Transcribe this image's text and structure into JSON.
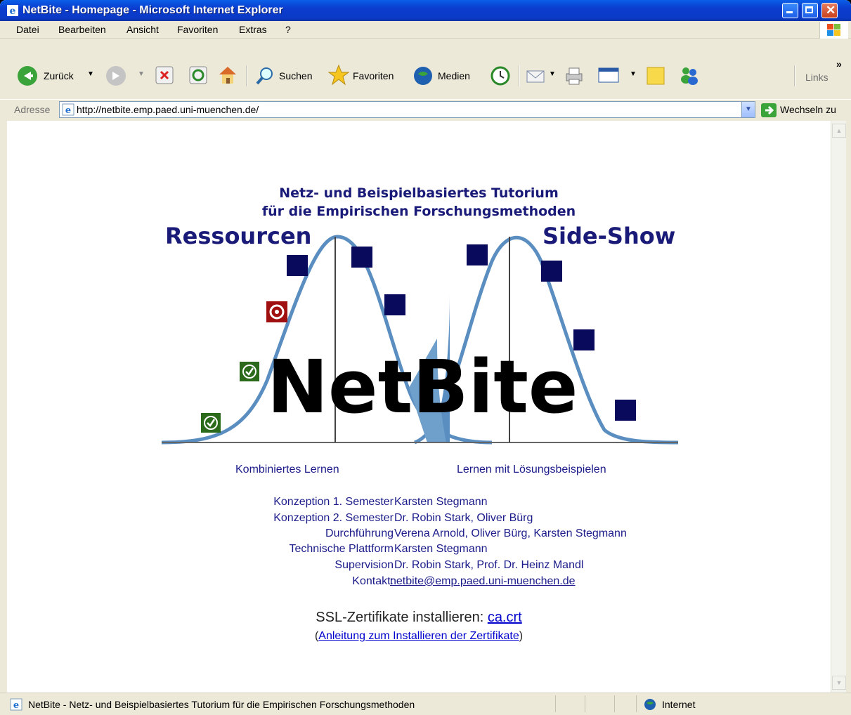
{
  "window": {
    "title": "NetBite - Homepage - Microsoft Internet Explorer"
  },
  "menu": [
    "Datei",
    "Bearbeiten",
    "Ansicht",
    "Favoriten",
    "Extras",
    "?"
  ],
  "toolbar": {
    "back": "Zurück",
    "search": "Suchen",
    "favorites": "Favoriten",
    "media": "Medien",
    "links": "Links"
  },
  "address": {
    "label": "Adresse",
    "url": "http://netbite.emp.paed.uni-muenchen.de/",
    "go": "Wechseln zu"
  },
  "page": {
    "heading_line1": "Netz- und Beispielbasiertes Tutorium",
    "heading_line2": "für die Empirischen Forschungsmethoden",
    "logo_left": "Ressourcen",
    "logo_right": "Side-Show",
    "logo_main": "NetBite",
    "links": {
      "left": "Kombiniertes Lernen",
      "right": "Lernen mit Lösungsbeispielen"
    },
    "credits": [
      {
        "label": "Konzeption 1. Semester",
        "value": "Karsten Stegmann"
      },
      {
        "label": "Konzeption 2. Semester",
        "value": "Dr. Robin Stark, Oliver Bürg"
      },
      {
        "label": "Durchführung",
        "value": "Verena Arnold, Oliver Bürg, Karsten Stegmann"
      },
      {
        "label": "Technische Plattform",
        "value": "Karsten Stegmann"
      },
      {
        "label": "Supervision",
        "value": "Dr. Robin Stark, Prof. Dr. Heinz Mandl"
      },
      {
        "label": "Kontakt:",
        "value": "netbite@emp.paed.uni-muenchen.de"
      }
    ],
    "ssl_text": "SSL-Zertifikate installieren: ",
    "ssl_link": "ca.crt",
    "guide_open": "(",
    "guide_link": "Anleitung zum Installieren der Zertifikate",
    "guide_close": ")"
  },
  "status": {
    "text": "NetBite - Netz- und Beispielbasiertes Tutorium für die Empirischen Forschungsmethoden",
    "zone": "Internet"
  },
  "colors": {
    "curve": "#5b8ec0",
    "square": "#0a0a5c",
    "check": "#2a6a1a",
    "target": "#a01010"
  }
}
